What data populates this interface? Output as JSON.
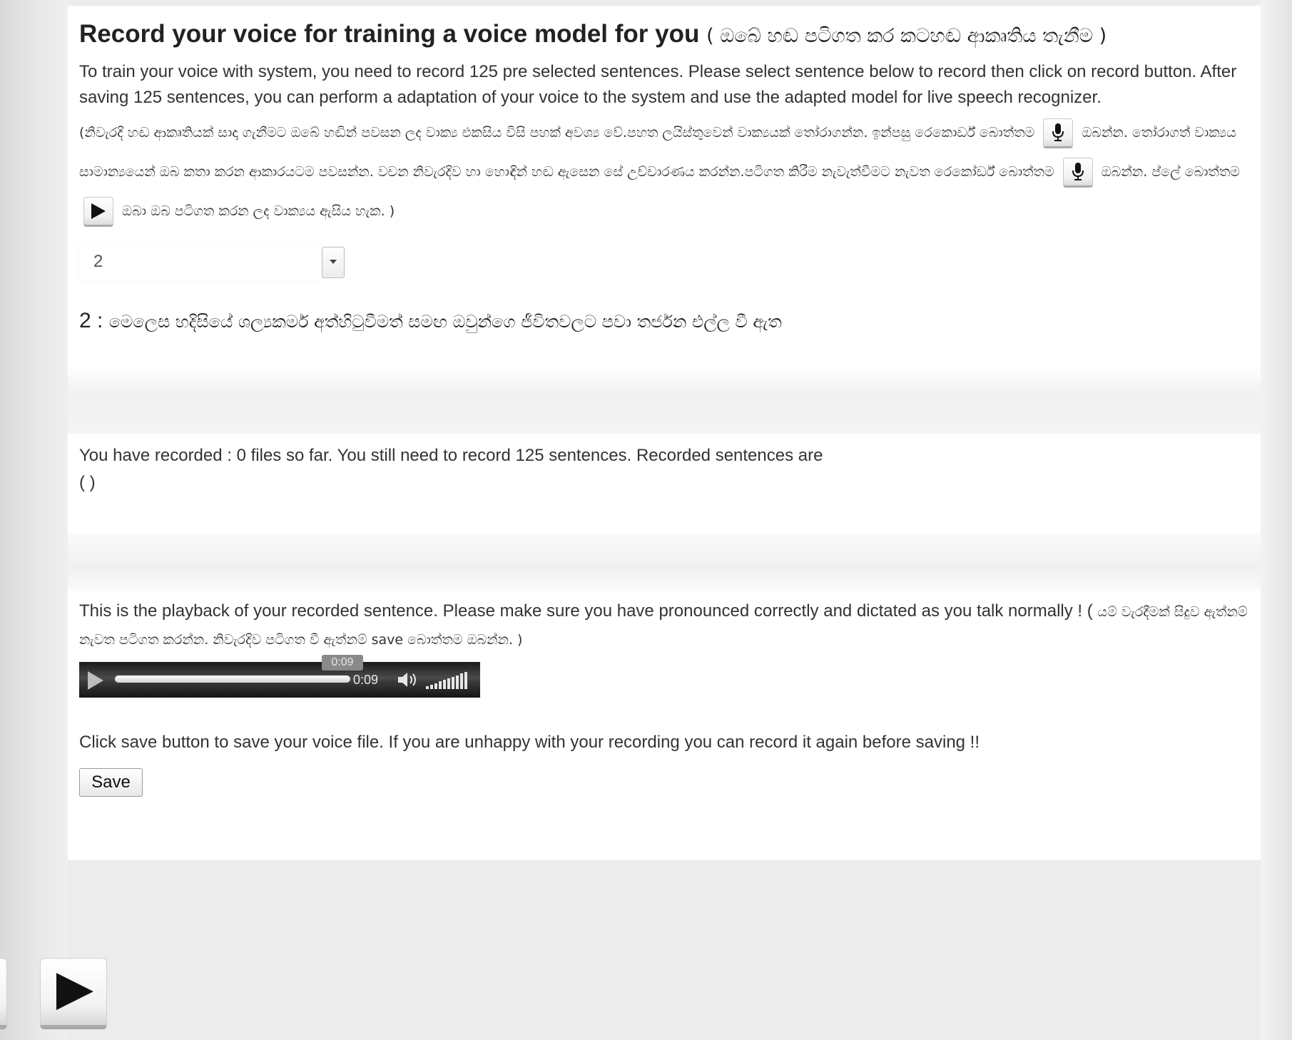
{
  "header": {
    "title_en": "Record your voice for training a voice model for you",
    "title_si": "( ඔබේ හඬ පටිගත කර කටහඬ ආකෘතිය තැනීම )"
  },
  "intro": {
    "english": "To train your voice with system, you need to record 125 pre selected sentences. Please select sentence below to record then click on record button. After saving 125 sentences, you can perform a adaptation of your voice to the system and use the adapted model for live speech recognizer.",
    "sinhala_part1": "(නිවැරදි හඬ ආකෘතියක් සාදා ගැනීමට ඔබේ හඬින් පවසන ලද වාක්‍ය එකසිය විසි පහක් අවශ්‍ය වේ.පහත ලයිස්තුවෙන් වාක්‍යයක් තෝරාගන්න. ඉන්පසු රෙකොර්ඩ් බොත්තම",
    "sinhala_part2": "ඔබන්න. තෝරාගත් වාක්‍යය සාමාන්‍යයෙන් ඔබ කතා කරන ආකාරයටම පවසන්න. වචන නිවැරදිව හා හොඳින් හඬ ඇසෙන සේ උච්චාරණය කරන්න.පටිගත කිරීම නැවැත්වීමට නැවත රෙකෝර්ඩ් බොත්තම",
    "sinhala_part3": "ඔබන්න. ප්ලේ බොත්තම",
    "sinhala_part4": "ඔබා ඔබ පටිගත කරන ලද වාක්‍යය ඇසිය හැක. )",
    "icons": [
      "microphone-icon",
      "microphone-icon",
      "play-icon"
    ]
  },
  "sentence_select": {
    "selected_value": "2"
  },
  "sentence": {
    "number": "2",
    "separator": " : ",
    "text": "මෙලෙස හදිසියේ ශල්‍යකර්ම අත්හිටුවීමත් සමඟ ඔවුන්ගෙ ජීවිතවලට පවා තර්ජන එල්ල වී ඇත"
  },
  "status": {
    "line1": "You have recorded : 0 files so far. You still need to record 125 sentences. Recorded sentences are",
    "line2": "( )"
  },
  "playback": {
    "text_en": "This is the playback of your recorded sentence. Please make sure you have pronounced correctly and dictated as you talk normally ! (",
    "text_si": "යම් වැරදීමක් සිදුව ඇත්නම් නැවත පටිගත කරන්න. නිවැරදිව පටිගත වී ඇත්නම් save බොත්තම ඔබන්න. )"
  },
  "player": {
    "tooltip": "0:09",
    "time": "0:09",
    "progress": 1.0,
    "volume_level": 1.0
  },
  "save": {
    "instruction": "Click save button to save your voice file. If you are unhappy with your recording you can record it again before saving !!",
    "button_label": "Save"
  },
  "colors": {
    "page_bg": "#ececec",
    "panel_bg": "#ffffff",
    "text": "#333333",
    "player_bg": "#3a3a3a"
  }
}
